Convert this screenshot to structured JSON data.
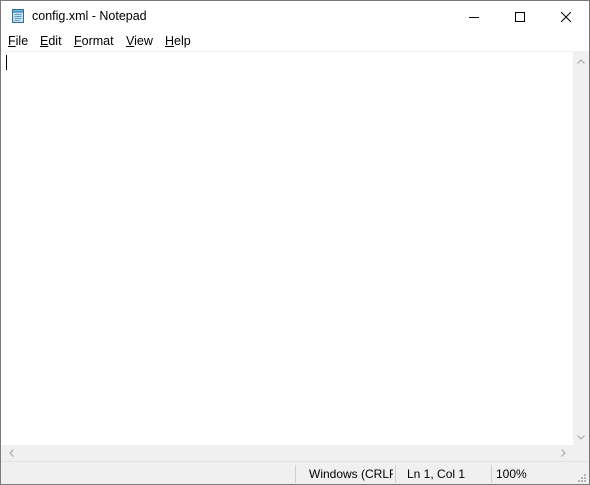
{
  "window": {
    "title": "config.xml - Notepad",
    "app_icon": "notepad-icon"
  },
  "caption_buttons": {
    "minimize_icon": "minimize-icon",
    "maximize_icon": "maximize-icon",
    "close_icon": "close-icon"
  },
  "menu": {
    "items": [
      {
        "accel": "F",
        "rest": "ile"
      },
      {
        "accel": "E",
        "rest": "dit"
      },
      {
        "accel": "F",
        "rest": "ormat"
      },
      {
        "accel": "V",
        "rest": "iew"
      },
      {
        "accel": "H",
        "rest": "elp"
      }
    ]
  },
  "editor": {
    "content": ""
  },
  "statusbar": {
    "encoding": "Windows (CRLF)",
    "position": "Ln 1, Col 1",
    "zoom": "100%"
  },
  "colors": {
    "chrome": "#f0f0f0",
    "border": "#7a7a7a",
    "scroll_arrow": "#a3a3a3"
  }
}
